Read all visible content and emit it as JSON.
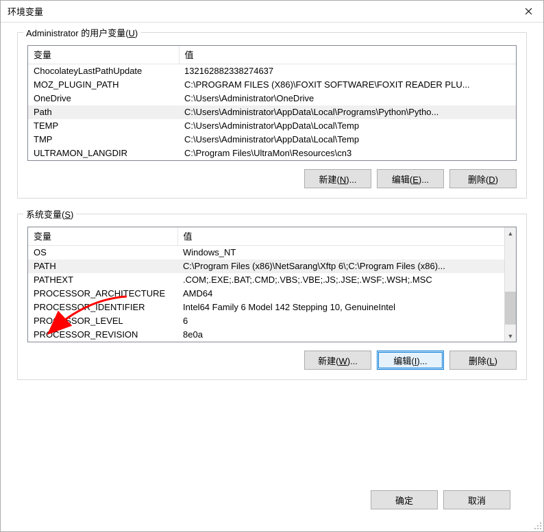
{
  "window_title": "环境变量",
  "user_section": {
    "legend_prefix": "Administrator 的用户变量(",
    "legend_key": "U",
    "legend_suffix": ")",
    "columns": {
      "variable": "变量",
      "value": "值"
    },
    "rows": [
      {
        "variable": "ChocolateyLastPathUpdate",
        "value": "132162882338274637",
        "selected": false
      },
      {
        "variable": "MOZ_PLUGIN_PATH",
        "value": "C:\\PROGRAM FILES (X86)\\FOXIT SOFTWARE\\FOXIT READER PLU...",
        "selected": false
      },
      {
        "variable": "OneDrive",
        "value": "C:\\Users\\Administrator\\OneDrive",
        "selected": false
      },
      {
        "variable": "Path",
        "value": "C:\\Users\\Administrator\\AppData\\Local\\Programs\\Python\\Pytho...",
        "selected": true
      },
      {
        "variable": "TEMP",
        "value": "C:\\Users\\Administrator\\AppData\\Local\\Temp",
        "selected": false
      },
      {
        "variable": "TMP",
        "value": "C:\\Users\\Administrator\\AppData\\Local\\Temp",
        "selected": false
      },
      {
        "variable": "ULTRAMON_LANGDIR",
        "value": "C:\\Program Files\\UltraMon\\Resources\\cn3",
        "selected": false
      }
    ],
    "buttons": {
      "new": {
        "label": "新建(",
        "key": "N",
        "suffix": ")..."
      },
      "edit": {
        "label": "编辑(",
        "key": "E",
        "suffix": ")..."
      },
      "delete": {
        "label": "删除(",
        "key": "D",
        "suffix": ")"
      }
    }
  },
  "system_section": {
    "legend_prefix": "系统变量(",
    "legend_key": "S",
    "legend_suffix": ")",
    "columns": {
      "variable": "变量",
      "value": "值"
    },
    "rows": [
      {
        "variable": "OS",
        "value": "Windows_NT",
        "selected": false
      },
      {
        "variable": "PATH",
        "value": "C:\\Program Files (x86)\\NetSarang\\Xftp 6\\;C:\\Program Files (x86)...",
        "selected": true
      },
      {
        "variable": "PATHEXT",
        "value": ".COM;.EXE;.BAT;.CMD;.VBS;.VBE;.JS;.JSE;.WSF;.WSH;.MSC",
        "selected": false
      },
      {
        "variable": "PROCESSOR_ARCHITECTURE",
        "value": "AMD64",
        "selected": false
      },
      {
        "variable": "PROCESSOR_IDENTIFIER",
        "value": "Intel64 Family 6 Model 142 Stepping 10, GenuineIntel",
        "selected": false
      },
      {
        "variable": "PROCESSOR_LEVEL",
        "value": "6",
        "selected": false
      },
      {
        "variable": "PROCESSOR_REVISION",
        "value": "8e0a",
        "selected": false
      }
    ],
    "buttons": {
      "new": {
        "label": "新建(",
        "key": "W",
        "suffix": ")..."
      },
      "edit": {
        "label": "编辑(",
        "key": "I",
        "suffix": ")..."
      },
      "delete": {
        "label": "删除(",
        "key": "L",
        "suffix": ")"
      }
    }
  },
  "footer": {
    "ok": "确定",
    "cancel": "取消"
  }
}
